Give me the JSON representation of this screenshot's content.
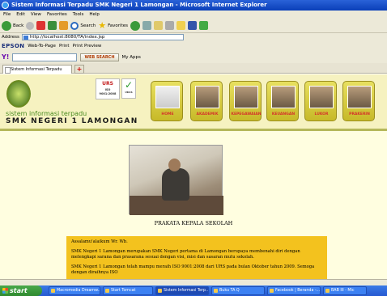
{
  "window": {
    "title": "Sistem Informasi Terpadu SMK Negeri 1 Lamongan - Microsoft Internet Explorer"
  },
  "menu": [
    "File",
    "Edit",
    "View",
    "Favorites",
    "Tools",
    "Help"
  ],
  "toolbar": {
    "back": "Back",
    "search": "Search",
    "favorites": "Favorites"
  },
  "address": {
    "label": "Address",
    "url": "http://localhost:8080/TA/index.jsp"
  },
  "epson": {
    "brand": "EPSON",
    "web_to_page": "Web-To-Page",
    "print": "Print",
    "print_preview": "Print Preview"
  },
  "yahoo": {
    "web_search": "WEB SEARCH",
    "my_apps": "My Apps"
  },
  "tab": {
    "label": "Sistem Informasi Terpadu SMK N..."
  },
  "header": {
    "line1": "sistem informasi terpadu",
    "line2": "SMK NEGERI 1 LAMONGAN",
    "urs": "URS",
    "urs_sub": "ISO 9001:2008"
  },
  "nav": [
    {
      "label": "HOME"
    },
    {
      "label": "AKADEMIK"
    },
    {
      "label": "KEPEGAWAIAN"
    },
    {
      "label": "KEUANGAN"
    },
    {
      "label": "LUKOR"
    },
    {
      "label": "PRAKERIN"
    }
  ],
  "main": {
    "caption": "PRAKATA KEPALA SEKOLAH",
    "p1": "Assalamu'alaikum Wr. Wb.",
    "p2": "SMK Negeri 1 Lamongan merupakan SMK Negeri pertama di Lamongan berupaya membenahi diri dengan melengkapi sarana dan prasarana sesuai dengan visi, misi dan sasaran mutu sekolah.",
    "p3": "SMK Negeri 1 Lamongan telah mampu meraih ISO 9001:2008 dari URS pada bulan Oktober tahun 2009. Semoga dengan diraihnya ISO"
  },
  "taskbar": {
    "start": "start",
    "items": [
      "Macromedia Dreamw...",
      "Start Tomcat",
      "Sistem Informasi Terp...",
      "Buku TA Q",
      "Facebook | Beranda -...",
      "BAB III - Mic"
    ]
  }
}
